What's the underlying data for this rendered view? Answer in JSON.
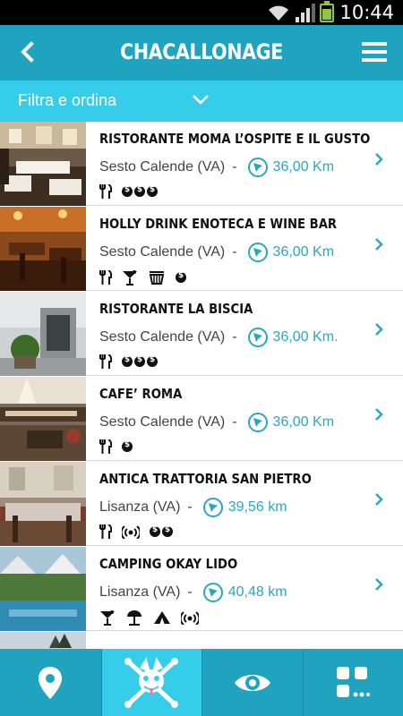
{
  "status_bar": {
    "time": "10:44",
    "icons": [
      "wifi-icon",
      "signal-icon",
      "battery-icon"
    ]
  },
  "header": {
    "title": "CHACALLONAGE",
    "back_icon": "chevron-left-icon",
    "menu_icon": "hamburger-menu-icon"
  },
  "filter": {
    "label": "Filtra e ordina",
    "icon": "chevron-down-icon"
  },
  "colors": {
    "primary": "#1fa3bf",
    "accent": "#36cdea",
    "distance_text": "#2aa7bf"
  },
  "items": [
    {
      "name": "RISTORANTE MOMA L’OSPITE E IL GUSTO",
      "location": "Sesto Calende (VA)",
      "separator": "-",
      "distance": "36,00 Km",
      "features": [
        "restaurant-icon",
        "price-3"
      ]
    },
    {
      "name": "HOLLY DRINK ENOTECA E WINE BAR",
      "location": "Sesto Calende (VA)",
      "separator": "-",
      "distance": "36,00 Km",
      "features": [
        "restaurant-icon",
        "cocktail-icon",
        "wine-basket-icon",
        "price-1"
      ]
    },
    {
      "name": "RISTORANTE LA BISCIA",
      "location": "Sesto Calende (VA)",
      "separator": "-",
      "distance": "36,00 Km.",
      "features": [
        "restaurant-icon",
        "price-3"
      ]
    },
    {
      "name": "CAFE’ ROMA",
      "location": "Sesto Calende (VA)",
      "separator": "-",
      "distance": "36,00 Km",
      "features": [
        "restaurant-icon",
        "price-1"
      ]
    },
    {
      "name": "ANTICA TRATTORIA SAN PIETRO",
      "location": "Lisanza (VA)",
      "separator": "-",
      "distance": "39,56 km",
      "features": [
        "restaurant-icon",
        "wifi-icon",
        "price-2"
      ]
    },
    {
      "name": "CAMPING OKAY LIDO",
      "location": "Lisanza (VA)",
      "separator": "-",
      "distance": "40,48 km",
      "features": [
        "cocktail-icon",
        "umbrella-icon",
        "tent-icon",
        "wifi-icon"
      ]
    }
  ],
  "tabs": [
    {
      "name": "map",
      "icon": "map-pin-icon",
      "active": false
    },
    {
      "name": "chacal",
      "icon": "chacal-logo-icon",
      "active": true
    },
    {
      "name": "view",
      "icon": "eye-icon",
      "active": false
    },
    {
      "name": "more",
      "icon": "grid-more-icon",
      "active": false
    }
  ]
}
